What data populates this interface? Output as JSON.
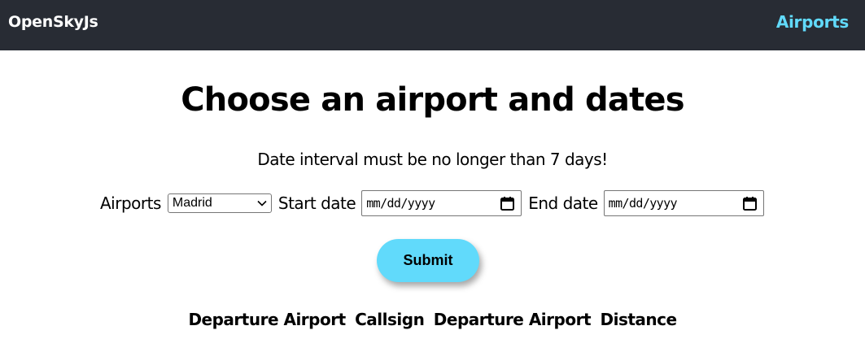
{
  "navbar": {
    "brand": "OpenSkyJs",
    "link_airports": "Airports",
    "link_color": "#61dafb",
    "background": "#282c34"
  },
  "main": {
    "title": "Choose an airport and dates",
    "notice": "Date interval must be no longer than 7 days!"
  },
  "form": {
    "airports_label": "Airports",
    "airport_selected": "Madrid",
    "start_date_label": "Start date",
    "start_date_placeholder": "mm/dd/yyyy",
    "end_date_label": "End date",
    "end_date_placeholder": "mm/dd/yyyy",
    "submit_label": "Submit",
    "submit_color": "#61dafb",
    "icons": {
      "select": "chevron-down-icon",
      "date": "calendar-icon"
    }
  },
  "table": {
    "headers": [
      "Departure Airport",
      "Callsign",
      "Departure Airport",
      "Distance"
    ]
  }
}
